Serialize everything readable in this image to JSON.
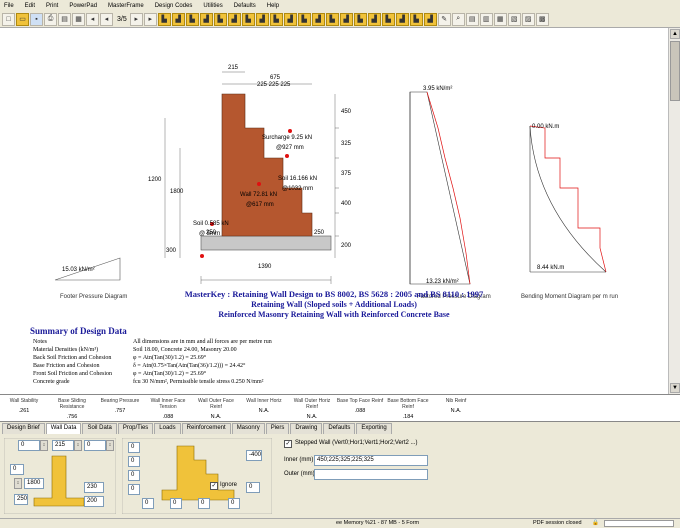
{
  "menu": [
    "File",
    "Edit",
    "Print",
    "PowerPad",
    "MasterFrame",
    "Design Codes",
    "Utilities",
    "Defaults",
    "Help"
  ],
  "toolbar": {
    "page_indicator": "3/5"
  },
  "drawing": {
    "dim_top_215": "215",
    "dim_top_675": "675",
    "dim_top_225": "225 225 225",
    "dim_450": "450",
    "dim_1200": "1200",
    "dim_1800": "1800",
    "dim_325": "325",
    "dim_375": "375",
    "dim_400": "400",
    "dim_300": "300",
    "dim_250a": "250",
    "dim_250b": "250",
    "dim_200": "200",
    "dim_1390": "1390",
    "surcharge": "Surcharge 9.25 kN",
    "surcharge_at": "@927 mm",
    "soil_16": "Soil 16.166 kN",
    "soil_16_at": "@1032 mm",
    "wall_label": "Wall 72.81 kN",
    "wall_at": "@617 mm",
    "soil_0": "Soil 0.585 kN",
    "soil_0_at": "@ 5mm",
    "pressure_top": "3.95 kN/m²",
    "pressure_bot": "13.23 kN/m²",
    "moment_top": "0.00 kN.m",
    "moment_bot": "8.44 kN.m",
    "footer_pressure": "15.03 kN/m²",
    "caption_footer": "Footer Pressure Diagram",
    "caption_factored": "Factored Pressure Diagram",
    "caption_moment": "Bending Moment Diagram per m run"
  },
  "titles": {
    "line1": "MasterKey : Retaining Wall Design to BS 8002, BS 5628 : 2005 and BS 8110 : 1997",
    "line2": "Retaining Wall (Sloped soils + Additional Loads)",
    "line3": "Reinforced Masonry Retaining Wall with Reinforced Concrete  Base"
  },
  "summary": {
    "heading": "Summary of Design Data",
    "rows": [
      {
        "k": "Notes",
        "v": "All dimensions are in mm and all forces are per metre run"
      },
      {
        "k": "Material Densities (kN/m³)",
        "v": "Soil 18.00, Concrete 24.00, Masonry 20.00"
      },
      {
        "k": "Back Soil Friction and Cohesion",
        "v": "φ = Atn(Tan(30)/1.2) = 25.69°"
      },
      {
        "k": "Base Friction and Cohesion",
        "v": "δ = Atn(0.75×Tan(Atn(Tan(36)/1.2))) = 24.42°"
      },
      {
        "k": "Front Soil Friction and Cohesion",
        "v": "φ = Atn(Tan(30)/1.2) = 25.69°"
      },
      {
        "k": "Concrete grade",
        "v": "fcu 30 N/mm², Permissible tensile stress 0.250 N/mm²"
      }
    ]
  },
  "results": [
    {
      "h": "Wall Stability",
      "v": ".261"
    },
    {
      "h": "Base Sliding Resistance",
      "v": ".756"
    },
    {
      "h": "Bearing Pressure",
      "v": ".757"
    },
    {
      "h": "Wall Inner Face Tension",
      "v": ".088"
    },
    {
      "h": "Wall Outer Face Reinf",
      "v": "N.A."
    },
    {
      "h": "Wall Inner Horiz",
      "v": "N.A."
    },
    {
      "h": "Wall Outer Horiz Reinf",
      "v": "N.A."
    },
    {
      "h": "Base Top Face Reinf",
      "v": ".088"
    },
    {
      "h": "Base Bottom Face Reinf",
      "v": ".184"
    },
    {
      "h": "Nib Reinf",
      "v": "N.A."
    }
  ],
  "tabs": [
    "Design Brief",
    "Wall Data",
    "Soil Data",
    "Prop/Ties",
    "Loads",
    "Reinforcement",
    "Masonry",
    "Piers",
    "Drawing",
    "Defaults",
    "Exporting"
  ],
  "panel": {
    "in_0a": "0",
    "in_215": "215",
    "in_0b": "0",
    "in_0c": "0",
    "in_1800": "1800",
    "in_230": "230",
    "in_250": "250",
    "in_200": "200",
    "in_d1": "0",
    "in_d2": "0",
    "in_d3": "0",
    "in_d4": "0",
    "in_d5": "0",
    "in_d6": "0",
    "in_d7": "0",
    "in_d8": "0",
    "in_d9": "0",
    "in_minus400": "-400",
    "ignore_label": "Ignore",
    "stepped_label": "Stepped Wall  (Vert0;Hor1;Vert1;Hor2;Vert2 ...)",
    "inner_label": "Inner (mm)",
    "inner_value": "450;225;325;225;325",
    "outer_label": "Outer (mm)",
    "outer_value": ""
  },
  "status": {
    "memory": "ee Memory %21 - 87 MB - 5 Form",
    "session": "PDF session closed"
  },
  "colors": {
    "wall": "#b5572f",
    "title": "#1a1a99",
    "dot": "#e01010"
  }
}
